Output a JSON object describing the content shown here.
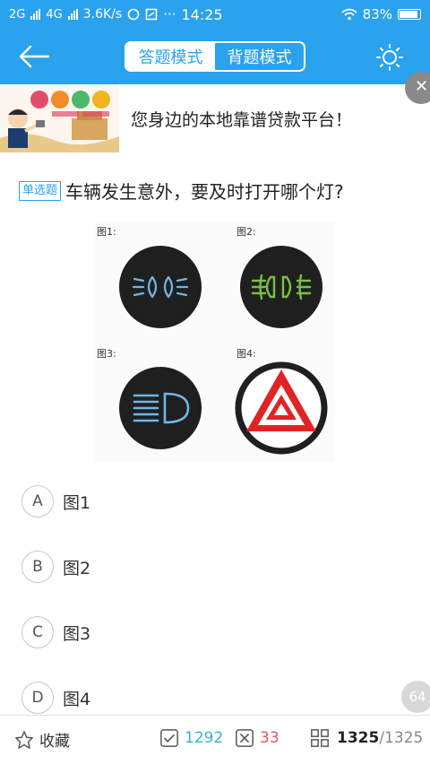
{
  "status_bar": {
    "network_left": "2G",
    "network_right": "4G",
    "speed": "3.6K/s",
    "more": "···",
    "time": "14:25",
    "battery": "83%"
  },
  "app_bar": {
    "modes": [
      "答题模式",
      "背题模式"
    ],
    "active_mode": "答题模式"
  },
  "ad": {
    "banner_text": "您身边的本地靠谱贷款平台！"
  },
  "question": {
    "type": "单选题",
    "text": "车辆发生意外，要及时打开哪个灯?",
    "figure_labels": [
      "图1:",
      "图2:",
      "图3:",
      "图4:"
    ]
  },
  "options": [
    {
      "letter": "A",
      "text": "图1"
    },
    {
      "letter": "B",
      "text": "图2"
    },
    {
      "letter": "C",
      "text": "图3"
    },
    {
      "letter": "D",
      "text": "图4"
    }
  ],
  "floating_badge": "64",
  "bottom_bar": {
    "favorite_label": "收藏",
    "correct_count": "1292",
    "wrong_count": "33",
    "current": "1325",
    "total": "/1325"
  },
  "colors": {
    "primary": "#2aa2ee",
    "correct": "#3bb0d6",
    "wrong": "#e05a5a"
  }
}
